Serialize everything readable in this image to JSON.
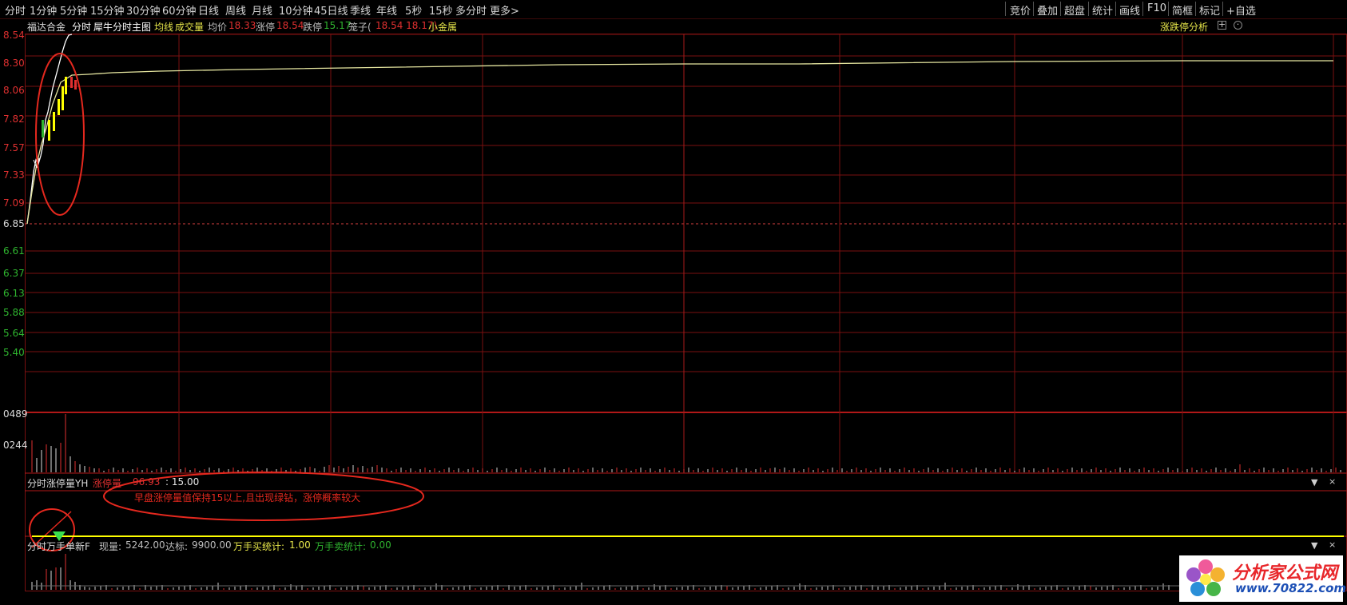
{
  "tabs_left": [
    "分时",
    "1分钟",
    "5分钟",
    "15分钟",
    "30分钟",
    "60分钟",
    "日线",
    "周线",
    "月线",
    "10分钟",
    "45日线",
    "季线",
    "年线",
    "5秒",
    "15秒",
    "多分时",
    "更多>"
  ],
  "tabs_right": [
    "竞价",
    "叠加",
    "超盘",
    "统计",
    "画线",
    "F10",
    "简框",
    "标记",
    "+自选"
  ],
  "info": {
    "stock_name": "福达合金",
    "mode": "分时",
    "indicator": "犀牛分时主图",
    "avg_line_label": "均线",
    "volume_label": "成交量",
    "avg_price_label": "均价",
    "avg_price_value": "18.33",
    "limit_up_label": "涨停",
    "limit_up_value": "18.54",
    "limit_down_label": "跌停",
    "limit_down_value": "15.17",
    "cage_label": "笼子(",
    "cage_value": "18.54 18.17)",
    "sector": "小金属",
    "analysis_link": "涨跌停分析"
  },
  "y_axis_labels": [
    "8.54",
    "8.30",
    "8.06",
    "7.82",
    "7.57",
    "7.33",
    "7.09",
    "6.85",
    "6.61",
    "6.37",
    "6.13",
    "5.88",
    "5.64",
    "5.40"
  ],
  "volume_axis_labels": [
    "0489",
    "0244"
  ],
  "panel2": {
    "title": "分时涨停量YH",
    "item_label": "涨停量",
    "item_value": "96.93",
    "item_threshold": ": 15.00",
    "annotation": "早盘涨停量值保持15以上,且出现绿钻，涨停概率较大"
  },
  "panel3": {
    "title": "分时万手单新F",
    "now_label": "现量:",
    "now_value": "5242.00",
    "target_label": "达标:",
    "target_value": "9900.00",
    "buy_label": "万手买统计:",
    "buy_value": "1.00",
    "sell_label": "万手卖统计:",
    "sell_value": "0.00"
  },
  "controls": {
    "collapse": "▼",
    "close": "×"
  },
  "watermark": {
    "text": "分析家公式网",
    "url": "www.70822.com"
  },
  "colors": {
    "background": "#000000",
    "grid": "#7a1010",
    "price_up": "#e03030",
    "price_down": "#2fb52f",
    "avg_line": "#e6e6a0",
    "highlight_yellow": "#ffff00",
    "annotation_red": "#e4281e"
  }
}
